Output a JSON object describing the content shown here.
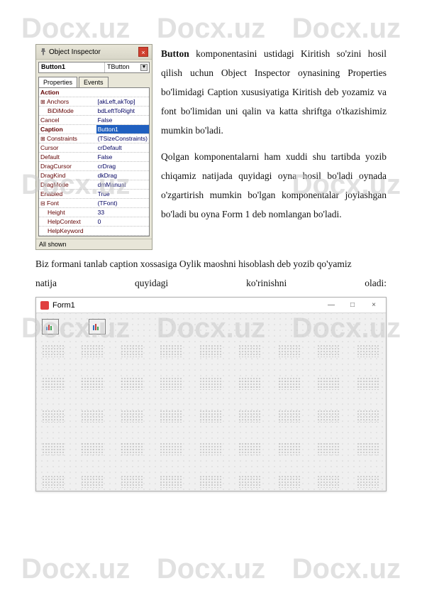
{
  "watermark": "Docx.uz",
  "inspector": {
    "title": "Object Inspector",
    "close_glyph": "×",
    "combo_name": "Button1",
    "combo_type": "TButton",
    "combo_arrow": "▼",
    "tabs": {
      "properties": "Properties",
      "events": "Events"
    },
    "rows": [
      {
        "name": "Action",
        "val": "",
        "style": "bold-label"
      },
      {
        "name": "Anchors",
        "val": "[akLeft,akTop]",
        "style": "expand"
      },
      {
        "name": "BiDiMode",
        "val": "bdLeftToRight",
        "style": "indent"
      },
      {
        "name": "Cancel",
        "val": "False",
        "style": ""
      },
      {
        "name": "Caption",
        "val": "Button1",
        "style": "selected bold-label"
      },
      {
        "name": "Constraints",
        "val": "(TSizeConstraints)",
        "style": "expand"
      },
      {
        "name": "Cursor",
        "val": "crDefault",
        "style": ""
      },
      {
        "name": "Default",
        "val": "False",
        "style": ""
      },
      {
        "name": "DragCursor",
        "val": "crDrag",
        "style": ""
      },
      {
        "name": "DragKind",
        "val": "dkDrag",
        "style": ""
      },
      {
        "name": "DragMode",
        "val": "dmManual",
        "style": ""
      },
      {
        "name": "Enabled",
        "val": "True",
        "style": ""
      },
      {
        "name": "Font",
        "val": "(TFont)",
        "style": "expanded"
      },
      {
        "name": "Height",
        "val": "33",
        "style": "indent"
      },
      {
        "name": "HelpContext",
        "val": "0",
        "style": "indent"
      },
      {
        "name": "HelpKeyword",
        "val": "",
        "style": "indent"
      }
    ],
    "status": "All shown"
  },
  "text": {
    "p1_bold": "Button",
    "p1": " komponentasini ustidagi Kiritish so'zini hosil qilish uchun Object Inspector oynasining  Properties bo'limidagi Caption xususiyatiga Kiritish deb yozamiz va font bo'limidan uni qalin va katta shriftga o'tkazishimiz mumkin bo'ladi.",
    "p2": "Qolgan komponentalarni ham xuddi shu tartibda yozib chiqamiz natijada quyidagi oyna hosil bo'ladi oynada o'zgartirish mumkin bo'lgan komponentalar joylashgan bo'ladi bu oyna Form 1 deb nomlangan bo'ladi.",
    "p3": "Biz formani tanlab caption xossasiga Oylik maoshni hisoblash deb yozib qo'yamiz",
    "natija": {
      "w1": "natija",
      "w2": "quyidagi",
      "w3": "ko'rinishni",
      "w4": "oladi:"
    }
  },
  "form": {
    "title": "Form1",
    "min_glyph": "—",
    "max_glyph": "□",
    "close_glyph": "×"
  }
}
